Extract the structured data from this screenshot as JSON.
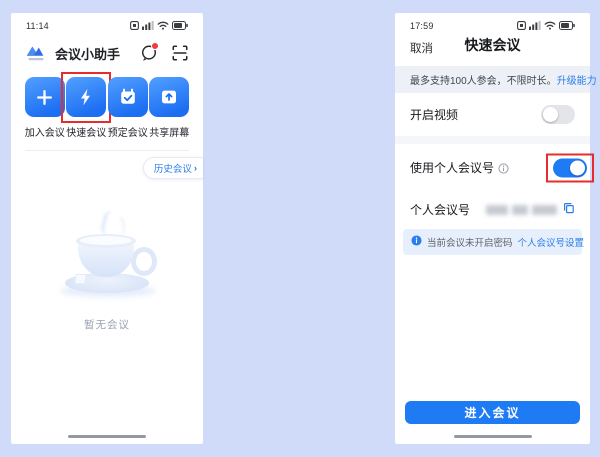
{
  "page": {
    "background_color": "#cfdbf8",
    "accent_blue": "#1f7bf4",
    "link_blue": "#2b7de9",
    "highlight_red": "#e62c2c"
  },
  "left_phone": {
    "status_time": "11:14",
    "status_icons": [
      "hd-icon",
      "signal-icon",
      "wifi-icon",
      "battery-icon"
    ],
    "header": {
      "logo_icon": "mountain-logo-icon",
      "title": "会议小助手",
      "right_icons": [
        "chat-icon",
        "scan-icon"
      ]
    },
    "actions": [
      {
        "label": "加入会议",
        "icon": "plus-icon",
        "highlighted": false
      },
      {
        "label": "快速会议",
        "icon": "lightning-icon",
        "highlighted": true
      },
      {
        "label": "预定会议",
        "icon": "calendar-check-icon",
        "highlighted": false
      },
      {
        "label": "共享屏幕",
        "icon": "screen-share-icon",
        "highlighted": false
      }
    ],
    "history_link": {
      "label": "历史会议",
      "chevron": "›"
    },
    "empty_state": {
      "text": "暂无会议",
      "illustration": "teacup"
    }
  },
  "right_phone": {
    "status_time": "17:59",
    "status_icons": [
      "hd-icon",
      "signal-icon",
      "wifi-icon",
      "battery-icon"
    ],
    "nav": {
      "cancel": "取消",
      "title": "快速会议"
    },
    "banner": {
      "text": "最多支持100人参会，不限时长。",
      "link": "升级能力"
    },
    "settings": {
      "video": {
        "label": "开启视频",
        "enabled": false
      },
      "personal_id": {
        "label": "使用个人会议号",
        "info_icon": "info-outline-icon",
        "enabled": true,
        "highlighted": true
      },
      "meeting_id": {
        "label": "个人会议号",
        "value_redacted": true,
        "copy_icon": "copy-icon"
      }
    },
    "info_bar": {
      "icon": "info-filled-icon",
      "text": "当前会议未开启密码",
      "link": "个人会议号设置"
    },
    "enter_button": "进入会议"
  }
}
